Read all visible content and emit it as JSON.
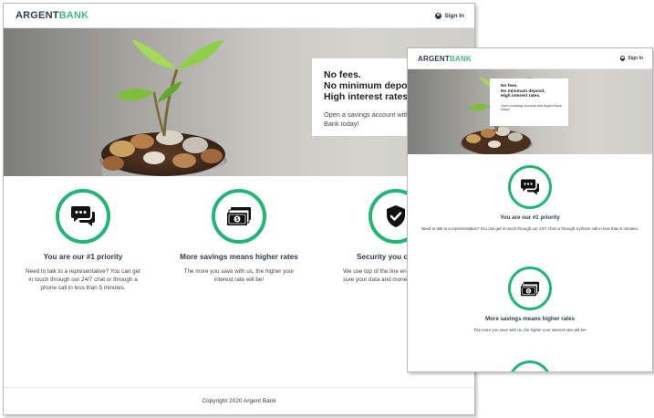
{
  "brand": {
    "part1": "ARGENT",
    "part2": "BANK"
  },
  "nav": {
    "signin_label": "Sign In",
    "user_icon": "user-circle-icon"
  },
  "desktop_hero": {
    "title_line1": "No fees.",
    "title_line2": "No minimum deposit.",
    "title_line3": "High interest rates.",
    "subtitle": "Open a savings account with Argent Bank today!"
  },
  "mobile_hero": {
    "title_line1": "No fees.",
    "title_line2": "No minimum deposit.",
    "title_line3": "High interest rates.",
    "subtitle": "Open a savings account with Argent Bank today!"
  },
  "features": [
    {
      "icon": "chat-icon",
      "title": "You are our #1 priority",
      "text": "Need to talk to a representative? You can get in touch through our 24/7 chat or through a phone call in less than 5 minutes."
    },
    {
      "icon": "money-icon",
      "title": "More savings means higher rates",
      "text": "The more you save with us, the higher your interest rate will be!"
    },
    {
      "icon": "security-icon",
      "title": "Security you can trust",
      "text": "We use top of the line encryption to make sure your data and money is always safe."
    }
  ],
  "footer": {
    "copyright": "Copyright 2020 Argent Bank"
  },
  "colors": {
    "accent": "#22b573",
    "brand_green": "#42b983",
    "text_dark": "#2c3e50"
  }
}
